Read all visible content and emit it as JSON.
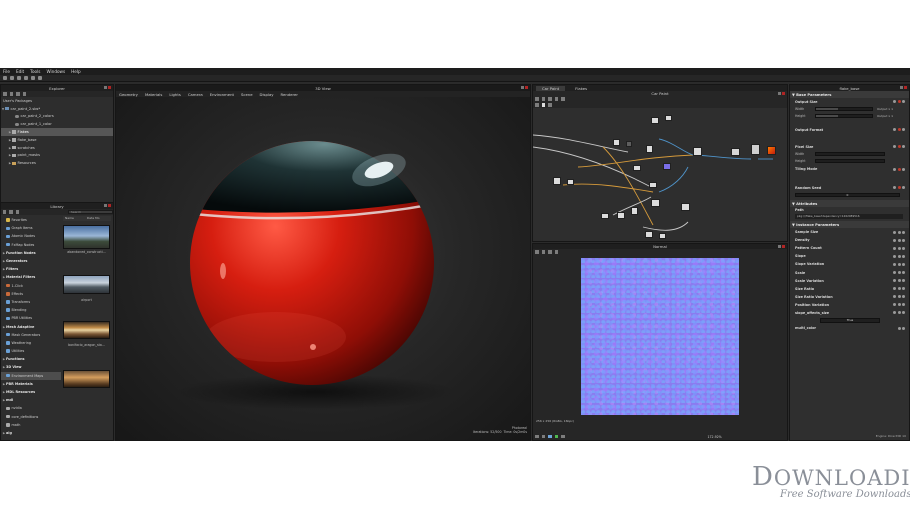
{
  "menu": [
    "File",
    "Edit",
    "Tools",
    "Windows",
    "Help"
  ],
  "explorer": {
    "title": "Explorer",
    "root": "User's Packages",
    "package": "car_paint_2.sbs*",
    "items": [
      "car_paint_2_colors",
      "car_paint_1_color",
      "Flakes",
      "flake_base",
      "scratches",
      "paint_masks",
      "Resources"
    ],
    "selected": 2
  },
  "library": {
    "title": "Library",
    "search_placeholder": "Search",
    "name_col": "Name",
    "date_col": "Date Mo",
    "items": [
      {
        "label": "Favorites",
        "header": false
      },
      {
        "label": "Graph Items",
        "header": false
      },
      {
        "label": "Atomic Nodes",
        "header": false
      },
      {
        "label": "FxMap Nodes",
        "header": false
      },
      {
        "label": "Function Nodes",
        "header": true
      },
      {
        "label": "Generators",
        "header": true
      },
      {
        "label": "Filters",
        "header": true
      },
      {
        "label": "Material Filters",
        "header": true
      },
      {
        "label": "1-Click",
        "header": false
      },
      {
        "label": "Effects",
        "header": false
      },
      {
        "label": "Transforms",
        "header": false
      },
      {
        "label": "Blending",
        "header": false
      },
      {
        "label": "PBR Utilities",
        "header": false
      },
      {
        "label": "Mesh Adaptive",
        "header": true
      },
      {
        "label": "Mask Generators",
        "header": false
      },
      {
        "label": "Weathering",
        "header": false
      },
      {
        "label": "Utilities",
        "header": false
      },
      {
        "label": "Functions",
        "header": true
      },
      {
        "label": "3D View",
        "header": true
      },
      {
        "label": "Environment Maps",
        "header": false
      },
      {
        "label": "PBR Materials",
        "header": true
      },
      {
        "label": "MDL Resources",
        "header": true
      },
      {
        "label": "mdl",
        "header": true
      },
      {
        "label": "nvidia",
        "header": false
      },
      {
        "label": "core_definitions",
        "header": false
      },
      {
        "label": "math",
        "header": false
      },
      {
        "label": "alg",
        "header": true
      }
    ],
    "selected": 19,
    "thumb_labels": [
      "abandoned_constructi...",
      "airport",
      "bonifacio_aragon_sta..."
    ]
  },
  "view3d": {
    "title": "3D View",
    "tabs": [
      "Geometry",
      "Materials",
      "Lights",
      "Camera",
      "Environment",
      "Scene",
      "Display",
      "Renderer"
    ],
    "status_renderer": "Photoreal",
    "status_iterations": "Iterations: 52/500",
    "status_time": "Time: 0s/2m0s"
  },
  "graph": {
    "tabs": [
      "Car Paint",
      "Flakes"
    ],
    "title": "Car Paint"
  },
  "view2d": {
    "title": "Normal",
    "status_left": "256 x 256 (RGBA, 16bpc)",
    "zoom": "172.92%",
    "colors": {
      "normal_base": "#8a7cf0"
    }
  },
  "properties": {
    "title": "flake_base",
    "base_params": "Base Parameters",
    "output_size": "Output Size",
    "width": "Width",
    "height": "Height",
    "width_val": "Default",
    "height_val": "Default",
    "inherit_w": "Output x 1",
    "inherit_h": "Output x 1",
    "output_format": "Output Format",
    "pixel_size": "Pixel Size",
    "tiling_mode": "Tiling Mode",
    "random_seed": "Random Seed",
    "seed_val": "0",
    "attributes": "Attributes",
    "path_label": "Path",
    "path_val": "pkg:///flake_base?dependency=1262989516",
    "instance_params": "Instance Parameters",
    "params": [
      "Sample Size",
      "Density",
      "Pattern Count",
      "Slope",
      "Slope Variation",
      "Scale",
      "Scale Variation",
      "Size Ratio",
      "Size Ratio Variation",
      "Position Variation",
      "slope_affects_size"
    ],
    "true_val": "True",
    "multi_color": "multi_color",
    "engine": "Engine: Direct3D 10"
  },
  "watermark": {
    "big_cap": "D",
    "big_rest": "OWNLOADIES",
    "small": "Free Software Downloads"
  }
}
